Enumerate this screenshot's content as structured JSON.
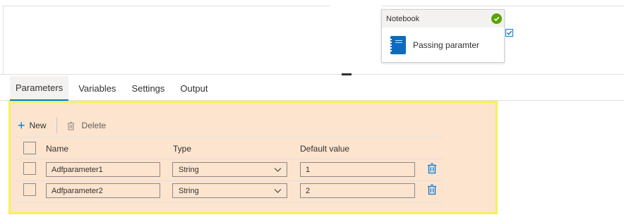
{
  "canvas": {
    "activity": {
      "type": "Notebook",
      "name": "Passing paramter",
      "status_icon": "success-check-icon",
      "icon": "notebook-icon"
    }
  },
  "tabs": [
    {
      "label": "Parameters",
      "active": true
    },
    {
      "label": "Variables",
      "active": false
    },
    {
      "label": "Settings",
      "active": false
    },
    {
      "label": "Output",
      "active": false
    }
  ],
  "toolbar": {
    "new_label": "New",
    "delete_label": "Delete"
  },
  "grid": {
    "columns": {
      "name": "Name",
      "type": "Type",
      "default": "Default value"
    },
    "rows": [
      {
        "name": "Adfparameter1",
        "type": "String",
        "default": "1"
      },
      {
        "name": "Adfparameter2",
        "type": "String",
        "default": "2"
      }
    ]
  },
  "colors": {
    "accent": "#0078d4",
    "success": "#57a300",
    "panel_bg": "#fde4cf",
    "panel_border": "#f6f15a"
  }
}
